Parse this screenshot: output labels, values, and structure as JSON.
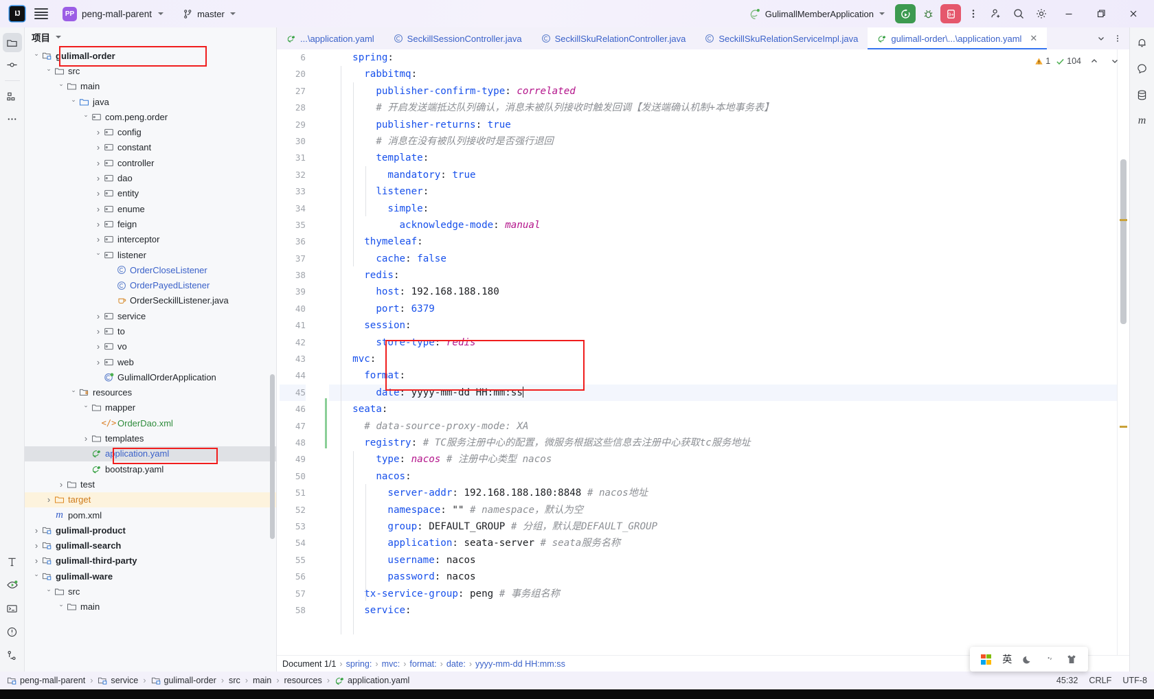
{
  "titlebar": {
    "ide_logo": "IJ",
    "project_badge": "PP",
    "project_name": "peng-mall-parent",
    "branch_name": "master",
    "run_config_name": "GulimallMemberApplication",
    "menu_icon": "hamburger-icon",
    "icons": {
      "run": "run-icon",
      "debug": "debug-icon",
      "services": "services-9-plus-icon",
      "more": "more-vertical-icon",
      "account": "account-add-icon",
      "search": "search-icon",
      "settings": "gear-icon",
      "minimize": "minimize-icon",
      "maximize": "maximize-icon",
      "close": "close-icon"
    }
  },
  "activitybar": {
    "items": [
      {
        "name": "project-tool-window",
        "icon": "folder-icon",
        "active": true
      },
      {
        "name": "commit-tool-window",
        "icon": "commit-icon",
        "active": false
      },
      {
        "name": "structure-tool-window",
        "icon": "structure-icon",
        "active": false
      },
      {
        "name": "more-tool-windows",
        "icon": "more-horizontal-icon",
        "active": false
      }
    ],
    "bottom_items": [
      {
        "name": "build-tool-window",
        "icon": "hammer-icon"
      },
      {
        "name": "run-tool-window",
        "icon": "run-dashboard-icon"
      },
      {
        "name": "terminal-tool-window",
        "icon": "terminal-icon"
      },
      {
        "name": "problems-tool-window",
        "icon": "warning-circle-icon"
      },
      {
        "name": "version-control-tool-window",
        "icon": "git-branch-icon"
      }
    ]
  },
  "rightbar": {
    "items": [
      {
        "name": "notifications",
        "icon": "bell-icon"
      },
      {
        "name": "ai-assistant",
        "icon": "ai-icon"
      },
      {
        "name": "database",
        "icon": "database-icon"
      },
      {
        "name": "maven",
        "icon": "maven-m-icon"
      }
    ]
  },
  "project_panel": {
    "title": "项目",
    "tree": [
      {
        "depth": 1,
        "arrow": "open",
        "icon": "module-icon",
        "label": "gulimall-order",
        "style": "bold",
        "boxed": true
      },
      {
        "depth": 2,
        "arrow": "open",
        "icon": "folder-icon",
        "label": "src",
        "style": ""
      },
      {
        "depth": 3,
        "arrow": "open",
        "icon": "folder-icon",
        "label": "main",
        "style": ""
      },
      {
        "depth": 4,
        "arrow": "open",
        "icon": "source-folder-icon",
        "label": "java",
        "style": ""
      },
      {
        "depth": 5,
        "arrow": "open",
        "icon": "package-icon",
        "label": "com.peng.order",
        "style": ""
      },
      {
        "depth": 6,
        "arrow": "closed",
        "icon": "package-icon",
        "label": "config",
        "style": ""
      },
      {
        "depth": 6,
        "arrow": "closed",
        "icon": "package-icon",
        "label": "constant",
        "style": ""
      },
      {
        "depth": 6,
        "arrow": "closed",
        "icon": "package-icon",
        "label": "controller",
        "style": ""
      },
      {
        "depth": 6,
        "arrow": "closed",
        "icon": "package-icon",
        "label": "dao",
        "style": ""
      },
      {
        "depth": 6,
        "arrow": "closed",
        "icon": "package-icon",
        "label": "entity",
        "style": ""
      },
      {
        "depth": 6,
        "arrow": "closed",
        "icon": "package-icon",
        "label": "enume",
        "style": ""
      },
      {
        "depth": 6,
        "arrow": "closed",
        "icon": "package-icon",
        "label": "feign",
        "style": ""
      },
      {
        "depth": 6,
        "arrow": "closed",
        "icon": "package-icon",
        "label": "interceptor",
        "style": ""
      },
      {
        "depth": 6,
        "arrow": "open",
        "icon": "package-icon",
        "label": "listener",
        "style": ""
      },
      {
        "depth": 7,
        "arrow": "none",
        "icon": "class-icon",
        "label": "OrderCloseListener",
        "style": "blue"
      },
      {
        "depth": 7,
        "arrow": "none",
        "icon": "class-icon",
        "label": "OrderPayedListener",
        "style": "blue"
      },
      {
        "depth": 7,
        "arrow": "none",
        "icon": "java-file-icon",
        "label": "OrderSeckillListener.java",
        "style": ""
      },
      {
        "depth": 6,
        "arrow": "closed",
        "icon": "package-icon",
        "label": "service",
        "style": ""
      },
      {
        "depth": 6,
        "arrow": "closed",
        "icon": "package-icon",
        "label": "to",
        "style": ""
      },
      {
        "depth": 6,
        "arrow": "closed",
        "icon": "package-icon",
        "label": "vo",
        "style": ""
      },
      {
        "depth": 6,
        "arrow": "closed",
        "icon": "package-icon",
        "label": "web",
        "style": ""
      },
      {
        "depth": 6,
        "arrow": "none",
        "icon": "spring-class-icon",
        "label": "GulimallOrderApplication",
        "style": ""
      },
      {
        "depth": 4,
        "arrow": "open",
        "icon": "resources-folder-icon",
        "label": "resources",
        "style": ""
      },
      {
        "depth": 5,
        "arrow": "open",
        "icon": "folder-icon",
        "label": "mapper",
        "style": ""
      },
      {
        "depth": 6,
        "arrow": "none",
        "icon": "xml-file-icon",
        "label": "OrderDao.xml",
        "style": "green-t"
      },
      {
        "depth": 5,
        "arrow": "closed",
        "icon": "folder-icon",
        "label": "templates",
        "style": ""
      },
      {
        "depth": 5,
        "arrow": "none",
        "icon": "yaml-file-icon",
        "label": "application.yaml",
        "style": "blue",
        "selected": true,
        "boxed": true
      },
      {
        "depth": 5,
        "arrow": "none",
        "icon": "yaml-file-icon",
        "label": "bootstrap.yaml",
        "style": ""
      },
      {
        "depth": 3,
        "arrow": "closed",
        "icon": "folder-icon",
        "label": "test",
        "style": ""
      },
      {
        "depth": 2,
        "arrow": "closed",
        "icon": "target-folder-icon",
        "label": "target",
        "style": "orange-t",
        "target_hl": true
      },
      {
        "depth": 2,
        "arrow": "none",
        "icon": "maven-m-icon",
        "label": "pom.xml",
        "style": ""
      },
      {
        "depth": 1,
        "arrow": "closed",
        "icon": "module-icon",
        "label": "gulimall-product",
        "style": "bold"
      },
      {
        "depth": 1,
        "arrow": "closed",
        "icon": "module-icon",
        "label": "gulimall-search",
        "style": "bold"
      },
      {
        "depth": 1,
        "arrow": "closed",
        "icon": "module-icon",
        "label": "gulimall-third-party",
        "style": "bold"
      },
      {
        "depth": 1,
        "arrow": "open",
        "icon": "module-icon",
        "label": "gulimall-ware",
        "style": "bold"
      },
      {
        "depth": 2,
        "arrow": "open",
        "icon": "folder-icon",
        "label": "src",
        "style": ""
      },
      {
        "depth": 3,
        "arrow": "open",
        "icon": "folder-icon",
        "label": "main",
        "style": ""
      }
    ]
  },
  "tabs": [
    {
      "label": "...\\application.yaml",
      "icon": "yaml-file-icon",
      "active": false
    },
    {
      "label": "SeckillSessionController.java",
      "icon": "class-icon",
      "active": false
    },
    {
      "label": "SeckillSkuRelationController.java",
      "icon": "class-icon",
      "active": false
    },
    {
      "label": "SeckillSkuRelationServiceImpl.java",
      "icon": "class-icon",
      "active": false
    },
    {
      "label": "gulimall-order\\...\\application.yaml",
      "icon": "yaml-file-icon",
      "active": true
    }
  ],
  "inspection": {
    "warning_count": "1",
    "ok_count": "104"
  },
  "code": {
    "lines": [
      {
        "no": "6",
        "indent": 1,
        "tokens": [
          {
            "t": "spring",
            "c": "k"
          },
          {
            "t": ":",
            "c": "v"
          }
        ]
      },
      {
        "no": "20",
        "indent": 2,
        "tokens": [
          {
            "t": "rabbitmq",
            "c": "k"
          },
          {
            "t": ":",
            "c": "v"
          }
        ]
      },
      {
        "no": "27",
        "indent": 3,
        "tokens": [
          {
            "t": "publisher-confirm-type",
            "c": "k"
          },
          {
            "t": ": ",
            "c": "v"
          },
          {
            "t": "correlated",
            "c": "s"
          }
        ]
      },
      {
        "no": "28",
        "indent": 3,
        "tokens": [
          {
            "t": "# 开启发送端抵达队列确认，消息未被队列接收时触发回调【发送端确认机制+本地事务表】",
            "c": "cm"
          }
        ]
      },
      {
        "no": "29",
        "indent": 3,
        "tokens": [
          {
            "t": "publisher-returns",
            "c": "k"
          },
          {
            "t": ": ",
            "c": "v"
          },
          {
            "t": "true",
            "c": "num"
          }
        ]
      },
      {
        "no": "30",
        "indent": 3,
        "tokens": [
          {
            "t": "# 消息在没有被队列接收时是否强行退回",
            "c": "cm"
          }
        ]
      },
      {
        "no": "31",
        "indent": 3,
        "tokens": [
          {
            "t": "template",
            "c": "k"
          },
          {
            "t": ":",
            "c": "v"
          }
        ]
      },
      {
        "no": "32",
        "indent": 4,
        "tokens": [
          {
            "t": "mandatory",
            "c": "k"
          },
          {
            "t": ": ",
            "c": "v"
          },
          {
            "t": "true",
            "c": "num"
          }
        ]
      },
      {
        "no": "33",
        "indent": 3,
        "tokens": [
          {
            "t": "listener",
            "c": "k"
          },
          {
            "t": ":",
            "c": "v"
          }
        ]
      },
      {
        "no": "34",
        "indent": 4,
        "tokens": [
          {
            "t": "simple",
            "c": "k"
          },
          {
            "t": ":",
            "c": "v"
          }
        ]
      },
      {
        "no": "35",
        "indent": 5,
        "tokens": [
          {
            "t": "acknowledge-mode",
            "c": "k"
          },
          {
            "t": ": ",
            "c": "v"
          },
          {
            "t": "manual",
            "c": "s"
          }
        ]
      },
      {
        "no": "36",
        "indent": 2,
        "tokens": [
          {
            "t": "thymeleaf",
            "c": "k"
          },
          {
            "t": ":",
            "c": "v"
          }
        ]
      },
      {
        "no": "37",
        "indent": 3,
        "tokens": [
          {
            "t": "cache",
            "c": "k"
          },
          {
            "t": ": ",
            "c": "v"
          },
          {
            "t": "false",
            "c": "num"
          }
        ]
      },
      {
        "no": "38",
        "indent": 2,
        "tokens": [
          {
            "t": "redis",
            "c": "k"
          },
          {
            "t": ":",
            "c": "v"
          }
        ]
      },
      {
        "no": "39",
        "indent": 3,
        "tokens": [
          {
            "t": "host",
            "c": "k"
          },
          {
            "t": ": ",
            "c": "v"
          },
          {
            "t": "192.168.188.180",
            "c": "v"
          }
        ]
      },
      {
        "no": "40",
        "indent": 3,
        "tokens": [
          {
            "t": "port",
            "c": "k"
          },
          {
            "t": ": ",
            "c": "v"
          },
          {
            "t": "6379",
            "c": "num"
          }
        ]
      },
      {
        "no": "41",
        "indent": 2,
        "tokens": [
          {
            "t": "session",
            "c": "k"
          },
          {
            "t": ":",
            "c": "v"
          }
        ]
      },
      {
        "no": "42",
        "indent": 3,
        "tokens": [
          {
            "t": "store-type",
            "c": "k"
          },
          {
            "t": ": ",
            "c": "v"
          },
          {
            "t": "redis",
            "c": "s"
          }
        ]
      },
      {
        "no": "43",
        "indent": 1,
        "tokens": [
          {
            "t": "mvc",
            "c": "k"
          },
          {
            "t": ":",
            "c": "v"
          }
        ]
      },
      {
        "no": "44",
        "indent": 2,
        "tokens": [
          {
            "t": "format",
            "c": "k"
          },
          {
            "t": ":",
            "c": "v"
          }
        ]
      },
      {
        "no": "45",
        "indent": 3,
        "tokens": [
          {
            "t": "date",
            "c": "k"
          },
          {
            "t": ": ",
            "c": "v"
          },
          {
            "t": "yyyy-mm-dd HH:mm:ss",
            "c": "v"
          }
        ],
        "highlight": true,
        "caret": true
      },
      {
        "no": "46",
        "indent": 1,
        "tokens": [
          {
            "t": "seata",
            "c": "k"
          },
          {
            "t": ":",
            "c": "v"
          }
        ]
      },
      {
        "no": "47",
        "indent": 2,
        "tokens": [
          {
            "t": "# data-source-proxy-mode: XA",
            "c": "cm"
          }
        ]
      },
      {
        "no": "48",
        "indent": 2,
        "tokens": [
          {
            "t": "registry",
            "c": "k"
          },
          {
            "t": ": ",
            "c": "v"
          },
          {
            "t": "# TC服务注册中心的配置，微服务根据这些信息去注册中心获取tc服务地址",
            "c": "cm"
          }
        ]
      },
      {
        "no": "49",
        "indent": 3,
        "tokens": [
          {
            "t": "type",
            "c": "k"
          },
          {
            "t": ": ",
            "c": "v"
          },
          {
            "t": "nacos",
            "c": "s"
          },
          {
            "t": " ",
            "c": "v"
          },
          {
            "t": "# 注册中心类型 nacos",
            "c": "cm"
          }
        ]
      },
      {
        "no": "50",
        "indent": 3,
        "tokens": [
          {
            "t": "nacos",
            "c": "k"
          },
          {
            "t": ":",
            "c": "v"
          }
        ]
      },
      {
        "no": "51",
        "indent": 4,
        "tokens": [
          {
            "t": "server-addr",
            "c": "k"
          },
          {
            "t": ": ",
            "c": "v"
          },
          {
            "t": "192.168.188.180:8848",
            "c": "v"
          },
          {
            "t": " ",
            "c": "v"
          },
          {
            "t": "# nacos地址",
            "c": "cm"
          }
        ]
      },
      {
        "no": "52",
        "indent": 4,
        "tokens": [
          {
            "t": "namespace",
            "c": "k"
          },
          {
            "t": ": ",
            "c": "v"
          },
          {
            "t": "\"\"",
            "c": "v"
          },
          {
            "t": " ",
            "c": "v"
          },
          {
            "t": "# namespace，默认为空",
            "c": "cm"
          }
        ]
      },
      {
        "no": "53",
        "indent": 4,
        "tokens": [
          {
            "t": "group",
            "c": "k"
          },
          {
            "t": ": ",
            "c": "v"
          },
          {
            "t": "DEFAULT_GROUP",
            "c": "v"
          },
          {
            "t": " ",
            "c": "v"
          },
          {
            "t": "# 分组，默认是DEFAULT_GROUP",
            "c": "cm"
          }
        ]
      },
      {
        "no": "54",
        "indent": 4,
        "tokens": [
          {
            "t": "application",
            "c": "k"
          },
          {
            "t": ": ",
            "c": "v"
          },
          {
            "t": "seata-server",
            "c": "v"
          },
          {
            "t": " ",
            "c": "v"
          },
          {
            "t": "# seata服务名称",
            "c": "cm"
          }
        ]
      },
      {
        "no": "55",
        "indent": 4,
        "tokens": [
          {
            "t": "username",
            "c": "k"
          },
          {
            "t": ": ",
            "c": "v"
          },
          {
            "t": "nacos",
            "c": "v"
          }
        ]
      },
      {
        "no": "56",
        "indent": 4,
        "tokens": [
          {
            "t": "password",
            "c": "k"
          },
          {
            "t": ": ",
            "c": "v"
          },
          {
            "t": "nacos",
            "c": "v"
          }
        ]
      },
      {
        "no": "57",
        "indent": 2,
        "tokens": [
          {
            "t": "tx-service-group",
            "c": "k"
          },
          {
            "t": ": ",
            "c": "v"
          },
          {
            "t": "peng",
            "c": "v"
          },
          {
            "t": " ",
            "c": "v"
          },
          {
            "t": "# 事务组名称",
            "c": "cm"
          }
        ]
      },
      {
        "no": "58",
        "indent": 2,
        "tokens": [
          {
            "t": "service",
            "c": "k"
          },
          {
            "t": ":",
            "c": "v"
          }
        ]
      }
    ]
  },
  "document_breadcrumb": {
    "document_label": "Document 1/1",
    "path": [
      "spring:",
      "mvc:",
      "format:",
      "date:",
      "yyyy-mm-dd HH:mm:ss"
    ]
  },
  "statusbar": {
    "breadcrumb": [
      {
        "label": "peng-mall-parent",
        "icon": "module-icon"
      },
      {
        "label": "service",
        "icon": "module-icon"
      },
      {
        "label": "gulimall-order",
        "icon": "module-icon"
      },
      {
        "label": "src",
        "icon": ""
      },
      {
        "label": "main",
        "icon": ""
      },
      {
        "label": "resources",
        "icon": ""
      },
      {
        "label": "application.yaml",
        "icon": "yaml-file-icon"
      }
    ],
    "caret_position": "45:32",
    "line_separator": "CRLF",
    "encoding": "UTF-8"
  },
  "ime_popup": {
    "items": [
      "windows-icon",
      "英",
      "moon-icon",
      "comma-icon",
      "shirt-icon"
    ]
  },
  "colors": {
    "accent": "#3574f0",
    "annotation_red": "#f01d1d",
    "run_green": "#3d9a50",
    "stop_red": "#e5576c",
    "selection_gray": "#dfe1e5",
    "target_highlight": "#fdf3dd"
  }
}
